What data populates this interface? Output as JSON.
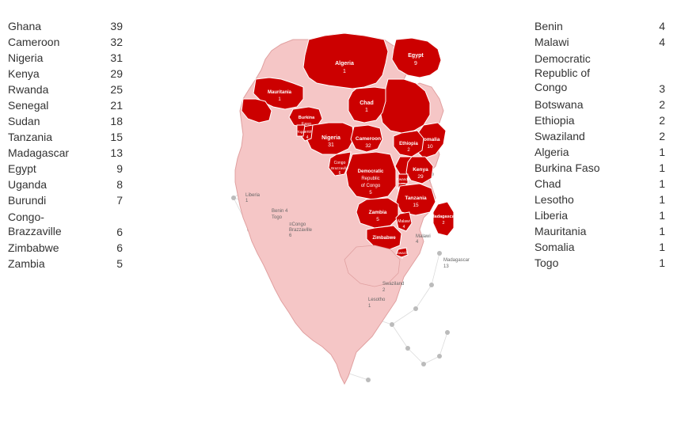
{
  "leftLegend": [
    {
      "country": "Ghana",
      "count": 39
    },
    {
      "country": "Cameroon",
      "count": 32
    },
    {
      "country": "Nigeria",
      "count": 31
    },
    {
      "country": "Kenya",
      "count": 29
    },
    {
      "country": "Rwanda",
      "count": 25
    },
    {
      "country": "Senegal",
      "count": 21
    },
    {
      "country": "Sudan",
      "count": 18
    },
    {
      "country": "Tanzania",
      "count": 15
    },
    {
      "country": "Madagascar",
      "count": 13
    },
    {
      "country": "Egypt",
      "count": 9
    },
    {
      "country": "Uganda",
      "count": 8
    },
    {
      "country": "Burundi",
      "count": 7
    },
    {
      "country": "Congo-\nBrazzaville",
      "count": 6
    },
    {
      "country": "Zimbabwe",
      "count": 6
    },
    {
      "country": "Zambia",
      "count": 5
    }
  ],
  "rightLegend": [
    {
      "country": "Benin",
      "count": 4
    },
    {
      "country": "Malawi",
      "count": 4
    },
    {
      "country": "Democratic\nRepublic of\nCongo",
      "count": 3
    },
    {
      "country": "Botswana",
      "count": 2
    },
    {
      "country": "Ethiopia",
      "count": 2
    },
    {
      "country": "Swaziland",
      "count": 2
    },
    {
      "country": "Algeria",
      "count": 1
    },
    {
      "country": "Burkina Faso",
      "count": 1
    },
    {
      "country": "Chad",
      "count": 1
    },
    {
      "country": "Lesotho",
      "count": 1
    },
    {
      "country": "Liberia",
      "count": 1
    },
    {
      "country": "Mauritania",
      "count": 1
    },
    {
      "country": "Somalia",
      "count": 1
    },
    {
      "country": "Togo",
      "count": 1
    }
  ],
  "mapLabels": {
    "algeria": "Algeria\n1",
    "egypt": "Egypt\n9",
    "mauritania": "Mauritania\n1",
    "burkinaFaso": "Burkina\nFaso",
    "nigeria": "Nigeria\n31",
    "chad": "Chad\n1",
    "liberia": "Liberia\n1",
    "benin": "Benin\n4",
    "togo": "Togo",
    "cameroon": "Cameroon\n32",
    "somalia": "Somalia\n10",
    "ethiopia": "Ethiopia\n2",
    "kenya": "Kenya\n29",
    "rwanda": "Rwanda\n25",
    "burundi": "Burundi\n2",
    "tanzania": "Tanzania\n15",
    "drc": "Democratic\nRepublic\nof Congo\n5",
    "congo": "Congo\nBrazzaville\n6",
    "zambia": "Zambia\n5",
    "malawi": "Malawi\n4",
    "zimbabwe": "Zimbabwe",
    "madagascar": "Madagascar\n2",
    "swaziland": "Swaziland\n2",
    "lesotho": "Lesotho\n1"
  }
}
